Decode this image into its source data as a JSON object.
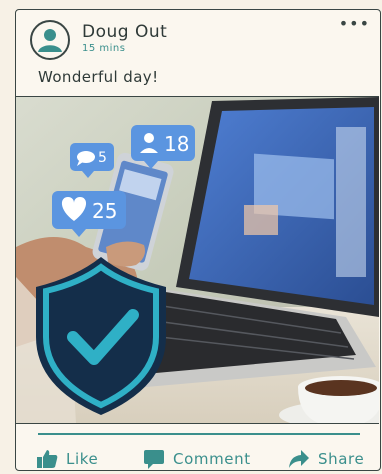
{
  "post": {
    "author": "Doug Out",
    "time": "15 mins",
    "status": "Wonderful day!",
    "menu_icon": "more-icon"
  },
  "photo": {
    "badges": {
      "followers": "18",
      "comments": "5",
      "likes": "25"
    }
  },
  "actions": {
    "like": "Like",
    "comment": "Comment",
    "share": "Share"
  },
  "colors": {
    "accent": "#3a8f8c",
    "ink": "#3a4644",
    "paper": "#fbf7ef",
    "shield": "#142e4a",
    "badge": "#5b95e0"
  }
}
